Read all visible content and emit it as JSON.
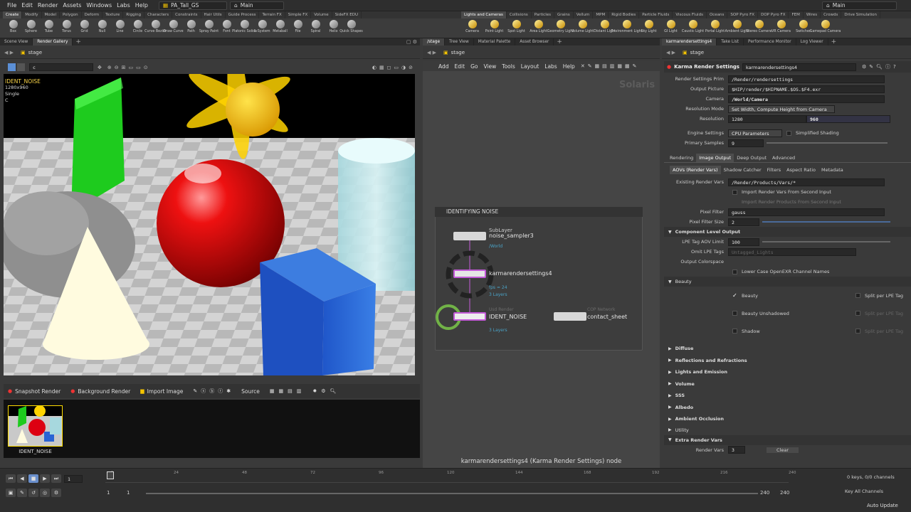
{
  "menubar": {
    "items": [
      "File",
      "Edit",
      "Render",
      "Assets",
      "Windows",
      "Labs",
      "Help"
    ],
    "desktop": "PA_Tall_GS",
    "context": "Main",
    "right_context": "Main"
  },
  "shelf_tabs_left": [
    "Create",
    "Modify",
    "Model",
    "Polygon",
    "Deform",
    "Texture",
    "Rigging",
    "Characters",
    "Constraints",
    "Hair Utils",
    "Guide Process",
    "Terrain FX",
    "Simple FX",
    "Volume",
    "SideFX EDU"
  ],
  "shelf_tabs_right": [
    "Lights and Cameras",
    "Collisions",
    "Particles",
    "Grains",
    "Vellum",
    "MPM",
    "Rigid Bodies",
    "Particle Fluids",
    "Viscous Fluids",
    "Oceans",
    "SOP Pyro FX",
    "DOP Pyro FX",
    "FEM",
    "Wires",
    "Crowds",
    "Drive Simulation"
  ],
  "shelf_tools_left": [
    "Box",
    "Sphere",
    "Tube",
    "Torus",
    "Grid",
    "Null",
    "Line",
    "Circle",
    "Curve Bezier",
    "Draw Curve",
    "Path",
    "Spray Paint",
    "Font",
    "Platonic Solids",
    "L-System",
    "Metaball",
    "File",
    "Spiral",
    "Helix",
    "Quick Shapes"
  ],
  "shelf_tools_right": [
    "Camera",
    "Point Light",
    "Spot Light",
    "Area Light",
    "Geometry Light",
    "Volume Light",
    "Distant Light",
    "Environment Light",
    "Sky Light",
    "GI Light",
    "Caustic Light",
    "Portal Light",
    "Ambient Light",
    "Stereo Camera",
    "VR Camera",
    "Switcher",
    "Gamepad Camera"
  ],
  "left_pane": {
    "tabs": [
      "Scene View",
      "Render Gallery"
    ],
    "path": "stage",
    "camera_field": "c",
    "overlay": {
      "name": "IDENT_NOISE",
      "res": "1280x960",
      "mode": "Single",
      "cam": "C"
    },
    "gallery_buttons": [
      "Snapshot Render",
      "Background Render",
      "Import Image",
      "Source"
    ],
    "thumb_label": "IDENT_NOISE"
  },
  "mid_pane": {
    "tabs": [
      "/stage",
      "Tree View",
      "Material Palette",
      "Asset Browser"
    ],
    "path": "stage",
    "menu": [
      "Add",
      "Edit",
      "Go",
      "View",
      "Tools",
      "Layout",
      "Labs",
      "Help"
    ],
    "watermark": "Solaris",
    "netbox_title": "IDENTIFYING NOISE",
    "nodes": [
      {
        "type": "SubLayer",
        "name": "noise_sampler3",
        "sub": "/World"
      },
      {
        "type": "",
        "name": "karmarendersettings4",
        "sub": "fps = 24",
        "sub2": "3 Layers"
      },
      {
        "type": "Usd Render",
        "name": "IDENT_NOISE",
        "sub": "",
        "sub2": "3 Layers"
      },
      {
        "type": "COP Network",
        "name": "contact_sheet",
        "sub": "",
        "sub2": ""
      }
    ],
    "footer": "karmarendersettings4 (Karma Render Settings) node"
  },
  "right_pane": {
    "tabs": [
      "karmarendersettings4",
      "Take List",
      "Performance Monitor",
      "Log Viewer"
    ],
    "path": "stage",
    "node_type": "Karma Render Settings",
    "node_name": "karmarendersettings4",
    "params": [
      {
        "label": "Render Settings Prim",
        "value": "/Render/rendersettings"
      },
      {
        "label": "Output Picture",
        "value": "$HIP/render/$HIPNAME.$OS.$F4.exr"
      },
      {
        "label": "Camera",
        "value": "/World/Camera"
      },
      {
        "label": "Resolution Mode",
        "value": "Set Width, Compute Height from Camera"
      }
    ],
    "resolution": {
      "label": "Resolution",
      "w": "1280",
      "h": "960"
    },
    "engine": {
      "label": "Engine Settings",
      "value": "CPU Parameters",
      "extra": "Simplified Shading"
    },
    "samples": {
      "label": "Primary Samples",
      "value": "9"
    },
    "main_tabs": [
      "Rendering",
      "Image Output",
      "Deep Output",
      "Advanced"
    ],
    "sub_tabs": [
      "AOVs (Render Vars)",
      "Shadow Catcher",
      "Filters",
      "Aspect Ratio",
      "Metadata"
    ],
    "existing": {
      "label": "Existing Render Vars",
      "value": "/Render/Products/Vars/*"
    },
    "import1": "Import Render Vars From Second Input",
    "import2": "Import Render Products From Second Input",
    "pixel_filter": {
      "label": "Pixel Filter",
      "value": "gauss"
    },
    "pixel_filter_size": {
      "label": "Pixel Filter Size",
      "value": "2"
    },
    "component_level": "Component Level Output",
    "lpe_limit": {
      "label": "LPE Tag AOV Limit",
      "value": "100"
    },
    "omit_lpe": {
      "label": "Omit LPE Tags",
      "value": "Untagged_Lights"
    },
    "output_colorspace": "Output Colorspace",
    "lower_case": "Lower Case OpenEXR Channel Names",
    "beauty_section": "Beauty",
    "beauty_items": [
      "Beauty",
      "Beauty Unshadowed",
      "Shadow"
    ],
    "split": "Split per LPE Tag",
    "sections": [
      "Diffuse",
      "Reflections and Refractions",
      "Lights and Emission",
      "Volume",
      "SSS",
      "Albedo",
      "Ambient Occlusion"
    ],
    "utility": "Utility",
    "extra_vars": "Extra Render Vars",
    "render_vars": {
      "label": "Render Vars",
      "value": "3",
      "clear": "Clear"
    }
  },
  "timeline": {
    "frame": "1",
    "ticks": [
      "1",
      "24",
      "48",
      "72",
      "96",
      "120",
      "144",
      "168",
      "192",
      "216",
      "240"
    ],
    "start": "1",
    "start2": "1",
    "end": "240",
    "end2": "240",
    "keys": "0 keys, 0/0 channels",
    "key_all": "Key All Channels",
    "auto_update": "Auto Update"
  },
  "colors": {
    "accent": "#f5c400",
    "selection_yellow": "#ffdd00",
    "node_purple": "#c35ad8",
    "node_green": "#7ed04a",
    "link_blue": "#4aa3c7"
  }
}
